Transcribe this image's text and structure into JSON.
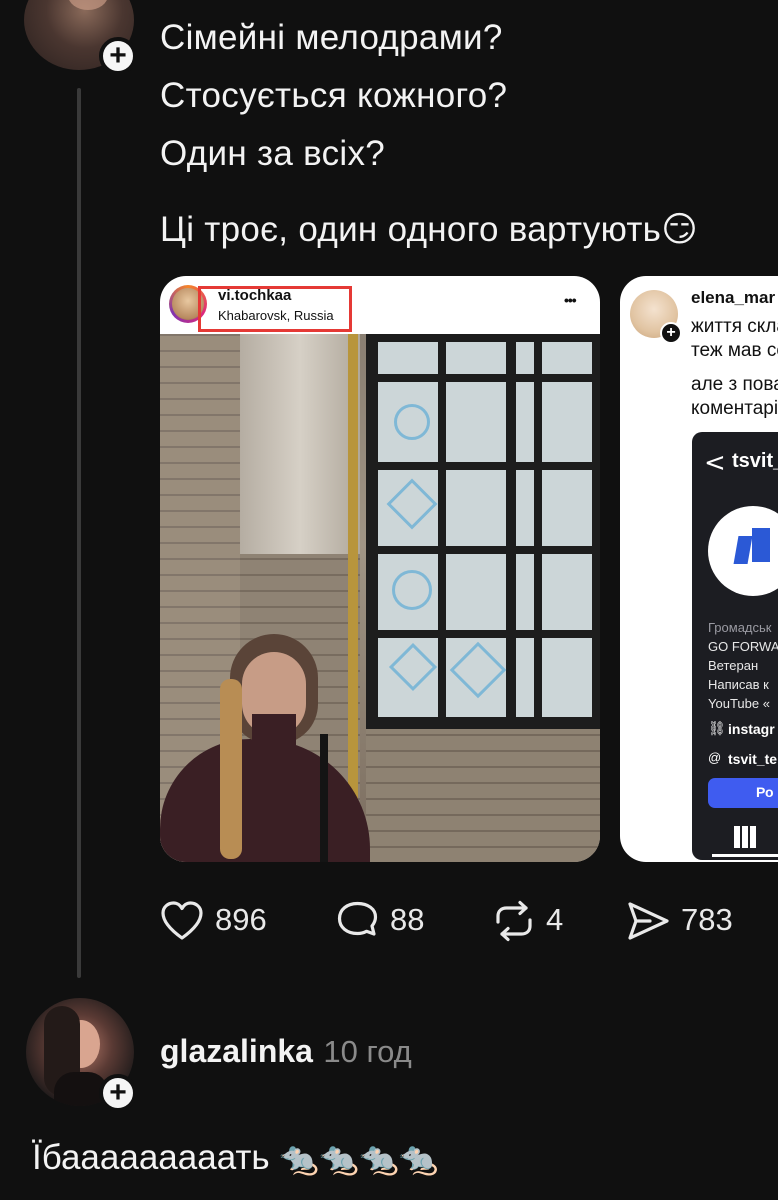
{
  "post": {
    "lines": [
      "Сімейні мелодрами?",
      "Стосується кожного?",
      "Один за всіх?"
    ],
    "last_line": "Ці троє, один одного вартують",
    "last_line_emoji": "😏"
  },
  "card1": {
    "username": "vi.tochkaa",
    "location": "Khabarovsk, Russia",
    "more": "•••"
  },
  "card2": {
    "username": "elena_mar",
    "line1": "життя скла",
    "line2": "теж мав се",
    "line3": "але з пова",
    "line4": "коментарі",
    "inner": {
      "back": "<",
      "profile": "tsvit_",
      "bio1": "Громадськ",
      "bio2": "GO FORWA",
      "bio3": "Ветеран",
      "bio4": "Написав к",
      "bio5": "YouTube «",
      "link1": "instagr",
      "link2": "tsvit_te",
      "button": "Ро"
    }
  },
  "stats": {
    "likes": "896",
    "comments": "88",
    "reposts": "4",
    "shares": "783"
  },
  "reply": {
    "username": "glazalinka",
    "time": "10 год",
    "text": "Їбааааааааать",
    "emojis": "🐀🐀🐀🐀"
  },
  "icons": {
    "like": "heart-icon",
    "comment": "comment-icon",
    "repost": "repost-icon",
    "share": "send-icon",
    "follow": "plus-icon"
  },
  "colors": {
    "background": "#101010",
    "highlight_box": "#e53935",
    "inner_button": "#3f5cf0"
  }
}
